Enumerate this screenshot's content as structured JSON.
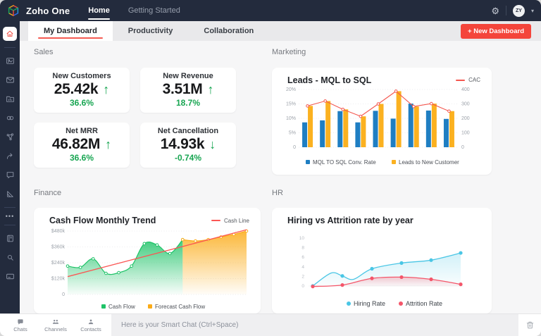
{
  "topbar": {
    "brand": "Zoho One",
    "nav": [
      {
        "label": "Home",
        "active": true
      },
      {
        "label": "Getting Started",
        "active": false
      }
    ],
    "avatar_initials": "ZY"
  },
  "tabs": {
    "items": [
      {
        "label": "My Dashboard",
        "active": true
      },
      {
        "label": "Productivity",
        "active": false
      },
      {
        "label": "Collaboration",
        "active": false
      }
    ],
    "new_dashboard_label": "+ New Dashboard"
  },
  "sections": {
    "sales": {
      "label": "Sales",
      "cards": [
        {
          "title": "New Customers",
          "value": "25.42k",
          "direction": "up",
          "change": "36.6%"
        },
        {
          "title": "New Revenue",
          "value": "3.51M",
          "direction": "up",
          "change": "18.7%"
        },
        {
          "title": "Net MRR",
          "value": "46.82M",
          "direction": "up",
          "change": "36.6%"
        },
        {
          "title": "Net Cancellation",
          "value": "14.93k",
          "direction": "down",
          "change": "-0.74%"
        }
      ]
    },
    "marketing": {
      "label": "Marketing",
      "chart_title": "Leads - MQL to SQL"
    },
    "finance": {
      "label": "Finance",
      "chart_title": "Cash Flow Monthly Trend"
    },
    "hr": {
      "label": "HR",
      "chart_title": "Hiring vs Attrition rate by year"
    }
  },
  "chart_data": [
    {
      "id": "marketing",
      "type": "bar",
      "title": "Leads - MQL to SQL",
      "categories": [
        "",
        "",
        "",
        "",
        "",
        "",
        "",
        "",
        ""
      ],
      "series": [
        {
          "name": "MQL TO SQL Conv. Rate",
          "type": "bar",
          "axis": "left",
          "color": "#1f7ec2",
          "values": [
            8.6,
            9.3,
            12.5,
            8.6,
            12.6,
            9.9,
            15.1,
            12.7,
            9.8
          ]
        },
        {
          "name": "Leads to New Customer",
          "type": "bar",
          "axis": "left",
          "color": "#fbb120",
          "values": [
            14.3,
            16,
            13.1,
            10.7,
            15,
            19.4,
            14.1,
            15.1,
            12.5
          ]
        },
        {
          "name": "CAC",
          "type": "line",
          "axis": "right",
          "color": "#f4564e",
          "values": [
            286,
            320,
            262,
            214,
            300,
            388,
            282,
            302,
            250
          ]
        }
      ],
      "left_axis": {
        "ticks": [
          "0",
          "5%",
          "10%",
          "15%",
          "20%"
        ],
        "max": 20
      },
      "right_axis": {
        "ticks": [
          "0",
          "100",
          "200",
          "300",
          "400"
        ],
        "max": 400
      },
      "grid": "dotted-horizontal",
      "legend_position": "bottom"
    },
    {
      "id": "finance",
      "type": "area",
      "title": "Cash Flow Monthly Trend",
      "series": [
        {
          "name": "Cash Flow",
          "type": "area",
          "color": "#1fc368",
          "x_start": 0,
          "values_k": [
            215,
            205,
            270,
            160,
            165,
            215,
            385,
            375,
            310,
            415
          ]
        },
        {
          "name": "Forecast Cash Flow",
          "type": "area",
          "color": "#fbab17",
          "x_start": 9,
          "values_k": [
            415,
            405,
            415,
            435,
            455,
            480
          ]
        },
        {
          "name": "Cash Line",
          "type": "line",
          "color": "#fb5654",
          "points_k": [
            [
              0,
              135
            ],
            [
              14,
              490
            ]
          ]
        }
      ],
      "y_axis": {
        "ticks": [
          "0",
          "$120k",
          "$240k",
          "$360k",
          "$480k"
        ],
        "max": 480
      },
      "grid": "dotted-horizontal",
      "legend_position": "bottom"
    },
    {
      "id": "hr",
      "type": "line",
      "title": "Hiring vs Attrition rate by year",
      "series": [
        {
          "name": "Hiring Rate",
          "color": "#4ac6e5",
          "values": [
            0,
            2.1,
            3.6,
            4.8,
            5.4,
            6.9
          ]
        },
        {
          "name": "Attrition Rate",
          "color": "#f4566a",
          "values": [
            -0.1,
            0.2,
            1.6,
            1.85,
            1.4,
            0.35
          ]
        }
      ],
      "y_axis": {
        "ticks": [
          "0",
          "2",
          "4",
          "6",
          "8",
          "10"
        ],
        "max": 10
      },
      "grid": "none",
      "legend_position": "bottom"
    }
  ],
  "bottombar": {
    "tabs": [
      {
        "label": "Chats"
      },
      {
        "label": "Channels"
      },
      {
        "label": "Contacts"
      }
    ],
    "smart_chat_placeholder": "Here is your Smart Chat (Ctrl+Space)"
  },
  "icons": {
    "gear": "⚙",
    "caret_down": "▾",
    "arrow_up": "↑",
    "arrow_down": "↓",
    "more_dots": "•••"
  },
  "colors": {
    "navy": "#232b3d",
    "accent_red": "#f0483e",
    "button_red": "#f4453b",
    "positive_green": "#17a551",
    "bar_blue": "#1f7ec2",
    "bar_yellow": "#fbb120",
    "cac_line_red": "#f4564e",
    "cash_flow_green": "#1fc368",
    "forecast_orange": "#fbab17",
    "cash_line_red": "#fb5654",
    "hiring_blue": "#4ac6e5",
    "attrition_red": "#f4566a"
  }
}
